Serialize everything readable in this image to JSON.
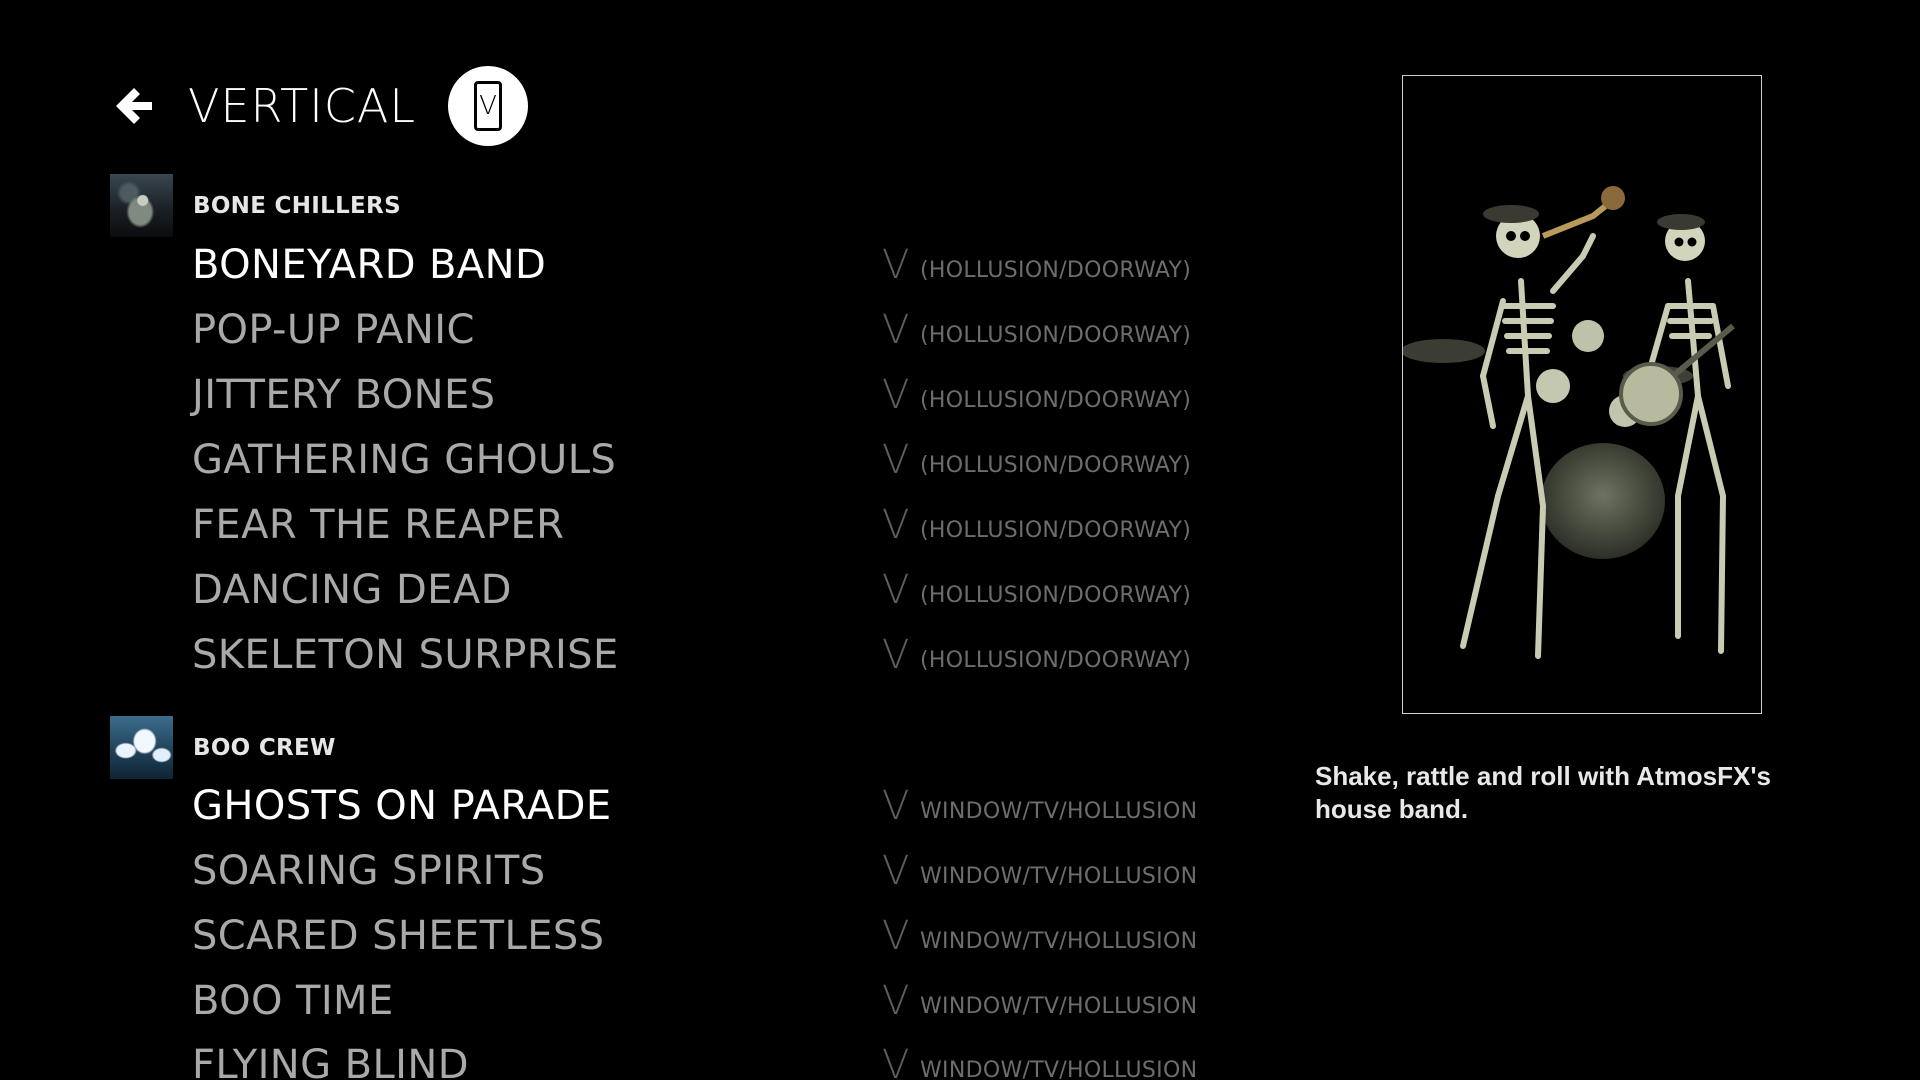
{
  "header": {
    "back_icon": "arrow-left-icon",
    "title": "VERTICAL",
    "format_badge_letter": "V",
    "format_badge_icon": "phone-vertical-icon"
  },
  "groups": [
    {
      "label": "BONE CHILLERS",
      "thumbnail_icon": "skeleton-thumbnail",
      "items": [
        {
          "title": "BONEYARD BAND",
          "v": "V",
          "format": "(HOLLUSION/DOORWAY)",
          "selected": true
        },
        {
          "title": "POP-UP PANIC",
          "v": "V",
          "format": "(HOLLUSION/DOORWAY)",
          "selected": false
        },
        {
          "title": "JITTERY BONES",
          "v": "V",
          "format": "(HOLLUSION/DOORWAY)",
          "selected": false
        },
        {
          "title": "GATHERING GHOULS",
          "v": "V",
          "format": "(HOLLUSION/DOORWAY)",
          "selected": false
        },
        {
          "title": "FEAR THE REAPER",
          "v": "V",
          "format": "(HOLLUSION/DOORWAY)",
          "selected": false
        },
        {
          "title": "DANCING DEAD",
          "v": "V",
          "format": "(HOLLUSION/DOORWAY)",
          "selected": false
        },
        {
          "title": "SKELETON SURPRISE",
          "v": "V",
          "format": "(HOLLUSION/DOORWAY)",
          "selected": false
        }
      ]
    },
    {
      "label": "BOO CREW",
      "thumbnail_icon": "ghosts-thumbnail",
      "items": [
        {
          "title": "GHOSTS ON PARADE",
          "v": "V",
          "format": "WINDOW/TV/HOLLUSION",
          "selected": true
        },
        {
          "title": "SOARING SPIRITS",
          "v": "V",
          "format": "WINDOW/TV/HOLLUSION",
          "selected": false
        },
        {
          "title": "SCARED SHEETLESS",
          "v": "V",
          "format": "WINDOW/TV/HOLLUSION",
          "selected": false
        },
        {
          "title": "BOO TIME",
          "v": "V",
          "format": "WINDOW/TV/HOLLUSION",
          "selected": false
        },
        {
          "title": "FLYING BLIND",
          "v": "V",
          "format": "WINDOW/TV/HOLLUSION",
          "selected": false
        }
      ]
    }
  ],
  "preview": {
    "image": "skeleton-band-preview",
    "description": "Shake, rattle and roll with AtmosFX's house band."
  },
  "colors": {
    "background": "#000000",
    "selected_text": "#ffffff",
    "unselected_text": "#a9a9a9",
    "format_text": "#6d6d6d"
  }
}
